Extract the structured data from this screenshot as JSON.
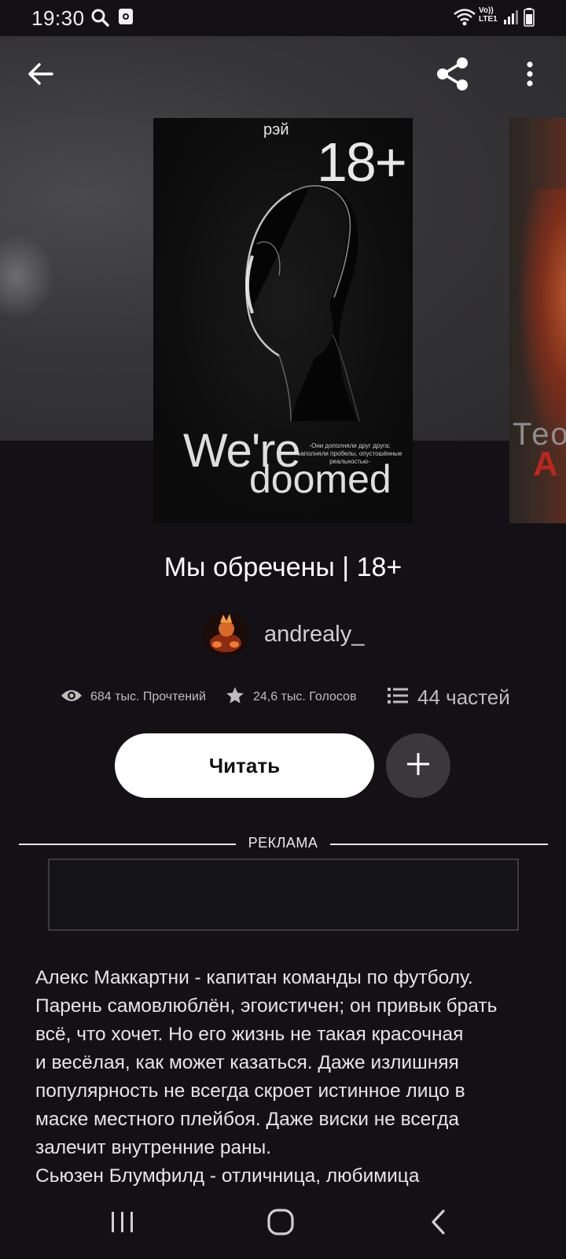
{
  "status_bar": {
    "time": "19:30",
    "network": "Vo)) LTE1",
    "icons": [
      "search-icon",
      "screenshot-icon",
      "wifi-icon",
      "signal-icon",
      "battery-icon"
    ]
  },
  "topbar": {
    "icons": [
      "back-arrow-icon",
      "share-icon",
      "more-vertical-icon"
    ]
  },
  "cover": {
    "author_text": "рэй",
    "rating": "18+",
    "tagline": "-Они дополняли друг друга; заполняли пробелы, опустошённые реальностью-",
    "title_line1": "We're",
    "title_line2": "doomed",
    "next_cover_text1": "Тео",
    "next_cover_text2": "А"
  },
  "book": {
    "title": "Мы обречены | 18+",
    "author": "andrealy_"
  },
  "stats": {
    "reads": "684 тыс. Прочтений",
    "votes": "24,6 тыс. Голосов",
    "parts": "44 частей"
  },
  "actions": {
    "read_label": "Читать"
  },
  "ad": {
    "label": "РЕКЛАМА"
  },
  "description": {
    "lines": [
      "Алекс Маккартни - капитан команды по футболу.",
      "Парень самовлюблён, эгоистичен; он привык брать",
      "всё, что хочет. Но его жизнь не такая красочная",
      "и весёлая, как может казаться. Даже излишняя",
      "популярность не всегда скроет истинное лицо в",
      "маске местного плейбоя. Даже виски не всегда",
      "залечит внутренние раны.",
      "Сьюзен Блумфилд - отличница, любимица"
    ]
  },
  "navbar": {
    "icons": [
      "recent-apps-icon",
      "home-icon",
      "back-icon"
    ]
  },
  "colors": {
    "background": "#131115",
    "header_bg": "#363537",
    "read_button": "#ffffff",
    "add_button": "#3a383c"
  }
}
